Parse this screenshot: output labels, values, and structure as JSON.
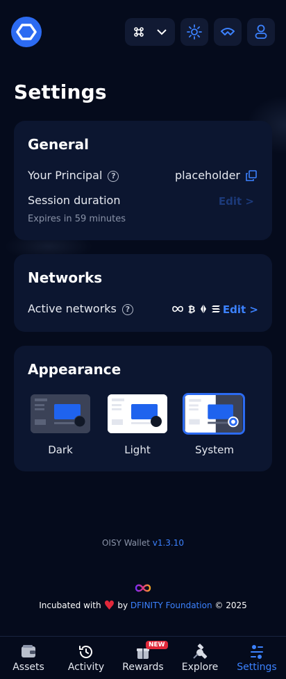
{
  "header": {
    "logo_icon": "oisy-logo",
    "buttons": [
      "network-switcher",
      "theme-toggle",
      "walletconnect",
      "user-menu"
    ]
  },
  "page": {
    "title": "Settings"
  },
  "general": {
    "title": "General",
    "principal_label": "Your Principal",
    "principal_value": "placeholder",
    "session_label": "Session duration",
    "session_edit": "Edit >",
    "session_expires": "Expires in 59 minutes"
  },
  "networks": {
    "title": "Networks",
    "active_label": "Active networks",
    "edit": "Edit >",
    "icons": [
      "icp-icon",
      "bitcoin-icon",
      "ethereum-icon",
      "solana-icon"
    ]
  },
  "appearance": {
    "title": "Appearance",
    "options": [
      {
        "label": "Dark",
        "selected": false
      },
      {
        "label": "Light",
        "selected": false
      },
      {
        "label": "System",
        "selected": true
      }
    ]
  },
  "footer": {
    "wallet_name": "OISY Wallet",
    "version": "v1.3.10",
    "incubated_prefix": "Incubated with",
    "by": "by",
    "foundation": "DFINITY Foundation",
    "copyright": "© 2025"
  },
  "nav": {
    "items": [
      {
        "label": "Assets",
        "active": false
      },
      {
        "label": "Activity",
        "active": false
      },
      {
        "label": "Rewards",
        "active": false,
        "badge": "NEW"
      },
      {
        "label": "Explore",
        "active": false
      },
      {
        "label": "Settings",
        "active": true
      }
    ]
  },
  "colors": {
    "accent": "#3c82ff",
    "background": "#050b1c",
    "card": "#0c1630",
    "badge": "#e0283a"
  }
}
